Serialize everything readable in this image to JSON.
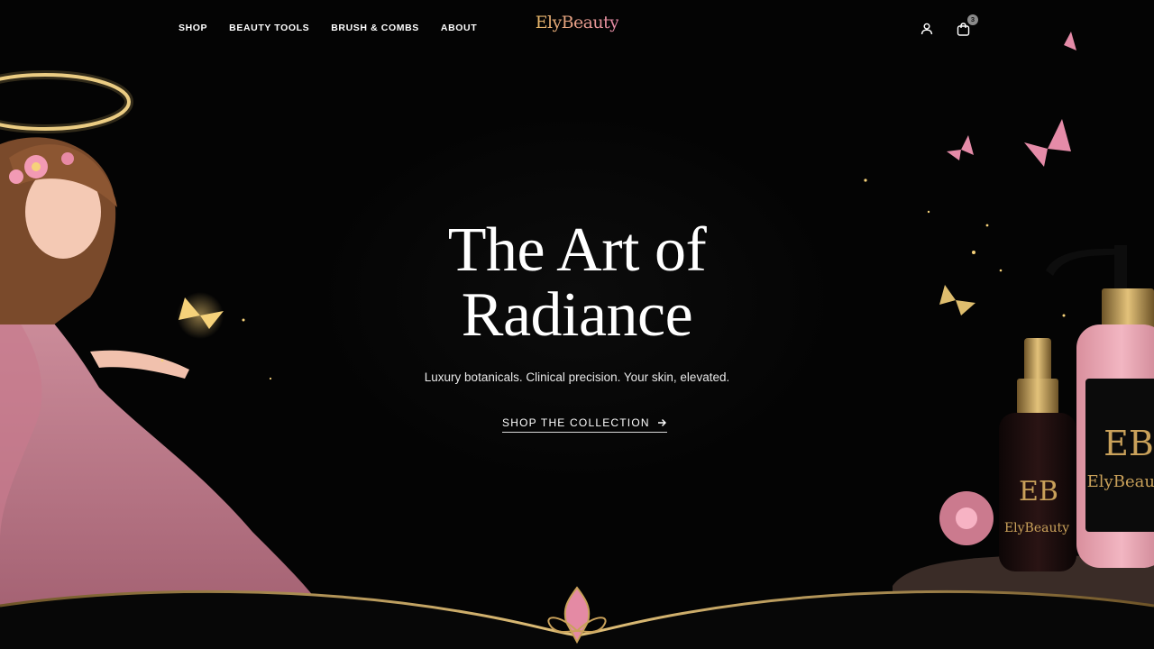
{
  "brand": {
    "logo_text": "ElyBeauty",
    "logo_colors": [
      "#e4b566",
      "#e8a08a",
      "#e489a8"
    ]
  },
  "nav": {
    "items": [
      {
        "label": "SHOP"
      },
      {
        "label": "BEAUTY TOOLS"
      },
      {
        "label": "BRUSH & COMBS"
      },
      {
        "label": "ABOUT"
      }
    ]
  },
  "header_icons": {
    "account_icon": "user-icon",
    "cart_icon": "shopping-bag-icon",
    "cart_count": "3"
  },
  "hero": {
    "title_line1": "The Art of",
    "title_line2": "Radiance",
    "subtitle": "Luxury botanicals. Clinical precision. Your skin, elevated.",
    "cta_label": "SHOP THE COLLECTION",
    "cta_icon": "arrow-right-icon",
    "product_label": "ElyBeauty",
    "product_monogram": "EB"
  },
  "colors": {
    "background": "#050505",
    "gold": "#c9a15a",
    "pink": "#e8a0b4",
    "text": "#ffffff"
  }
}
